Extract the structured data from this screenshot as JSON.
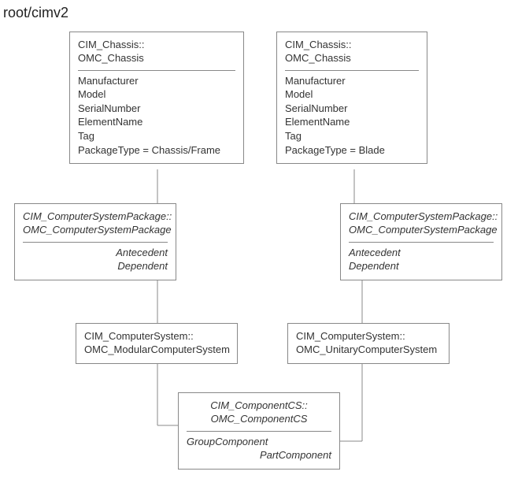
{
  "title": "root/cimv2",
  "boxes": {
    "chassis_left": {
      "header1": "CIM_Chassis::",
      "header2": "OMC_Chassis",
      "attrs": [
        "Manufacturer",
        "Model",
        "SerialNumber",
        "ElementName",
        "Tag",
        "PackageType = Chassis/Frame"
      ]
    },
    "chassis_right": {
      "header1": "CIM_Chassis::",
      "header2": "OMC_Chassis",
      "attrs": [
        "Manufacturer",
        "Model",
        "SerialNumber",
        "ElementName",
        "Tag",
        "PackageType = Blade"
      ]
    },
    "csp_left": {
      "header1": "CIM_ComputerSystemPackage::",
      "header2": "OMC_ComputerSystemPackage",
      "roles": [
        "Antecedent",
        "Dependent"
      ]
    },
    "csp_right": {
      "header1": "CIM_ComputerSystemPackage::",
      "header2": "OMC_ComputerSystemPackage",
      "roles": [
        "Antecedent",
        "Dependent"
      ]
    },
    "cs_left": {
      "header1": "CIM_ComputerSystem::",
      "header2": "OMC_ModularComputerSystem"
    },
    "cs_right": {
      "header1": "CIM_ComputerSystem::",
      "header2": "OMC_UnitaryComputerSystem"
    },
    "componentcs": {
      "header1": "CIM_ComponentCS::",
      "header2": "OMC_ComponentCS",
      "roles": [
        "GroupComponent",
        "PartComponent"
      ]
    }
  }
}
